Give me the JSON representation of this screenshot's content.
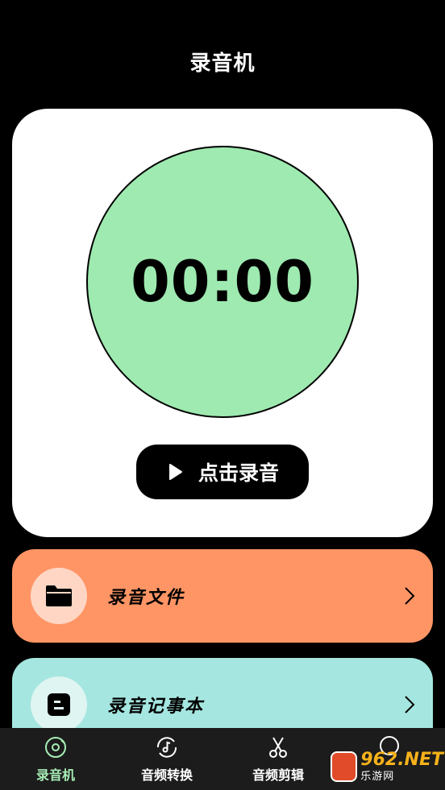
{
  "header": {
    "title": "录音机"
  },
  "recorder": {
    "timer": "00:00",
    "record_button_label": "点击录音",
    "circle_color": "#9eeab0"
  },
  "cards": [
    {
      "label": "录音文件",
      "icon": "folder-icon",
      "color": "#ff9565"
    },
    {
      "label": "录音记事本",
      "icon": "notes-icon",
      "color": "#a5e6e0"
    }
  ],
  "tabs": [
    {
      "label": "录音机",
      "icon": "record-disc-icon",
      "active": true
    },
    {
      "label": "音频转换",
      "icon": "audio-convert-icon",
      "active": false
    },
    {
      "label": "音频剪辑",
      "icon": "scissors-icon",
      "active": false
    },
    {
      "label": "",
      "icon": "profile-icon",
      "active": false
    }
  ],
  "watermark": {
    "main": "962.NET",
    "sub": "乐游网"
  },
  "colors": {
    "accent": "#a7eeb6",
    "background": "#000000"
  }
}
